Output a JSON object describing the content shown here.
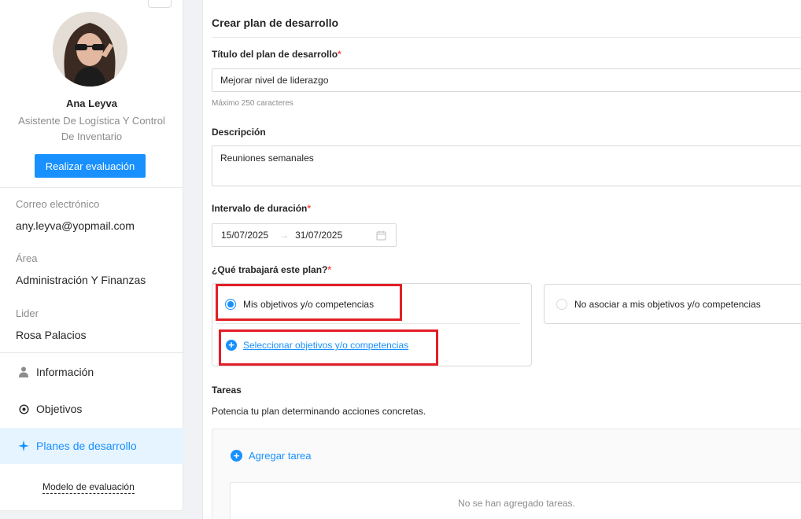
{
  "profile": {
    "name": "Ana Leyva",
    "role": "Asistente De Logística Y Control De Inventario",
    "evaluate_button": "Realizar evaluación"
  },
  "info": {
    "email_label": "Correo electrónico",
    "email_value": "any.leyva@yopmail.com",
    "area_label": "Área",
    "area_value": "Administración Y Finanzas",
    "leader_label": "Lider",
    "leader_value": "Rosa Palacios"
  },
  "menu": {
    "items": [
      {
        "label": "Información",
        "icon": "user-icon",
        "active": false
      },
      {
        "label": "Objetivos",
        "icon": "target-icon",
        "active": false
      },
      {
        "label": "Planes de desarrollo",
        "icon": "sparkle-icon",
        "active": true
      }
    ],
    "model_link": "Modelo de evaluación"
  },
  "form": {
    "header": "Crear plan de desarrollo",
    "title_label": "Título del plan de desarrollo",
    "required_mark": "*",
    "title_value": "Mejorar nivel de liderazgo",
    "title_hint": "Máximo 250 caracteres",
    "description_label": "Descripción",
    "description_value": "Reuniones semanales",
    "interval_label": "Intervalo de duración",
    "start_date": "15/07/2025",
    "range_separator": "→",
    "end_date": "31/07/2025",
    "work_question": "¿Qué trabajará este plan?",
    "option_objectives": "Mis objetivos y/o competencias",
    "option_none": "No asociar a mis objetivos y/o competencias",
    "select_link": "Seleccionar objetivos y/o competencias",
    "tasks_label": "Tareas",
    "tasks_description": "Potencia tu plan determinando acciones concretas.",
    "add_task": "Agregar tarea",
    "empty_tasks": "No se han agregado tareas."
  },
  "colors": {
    "primary": "#1890ff",
    "highlight": "#e41e26",
    "required": "#ff4d4f"
  }
}
